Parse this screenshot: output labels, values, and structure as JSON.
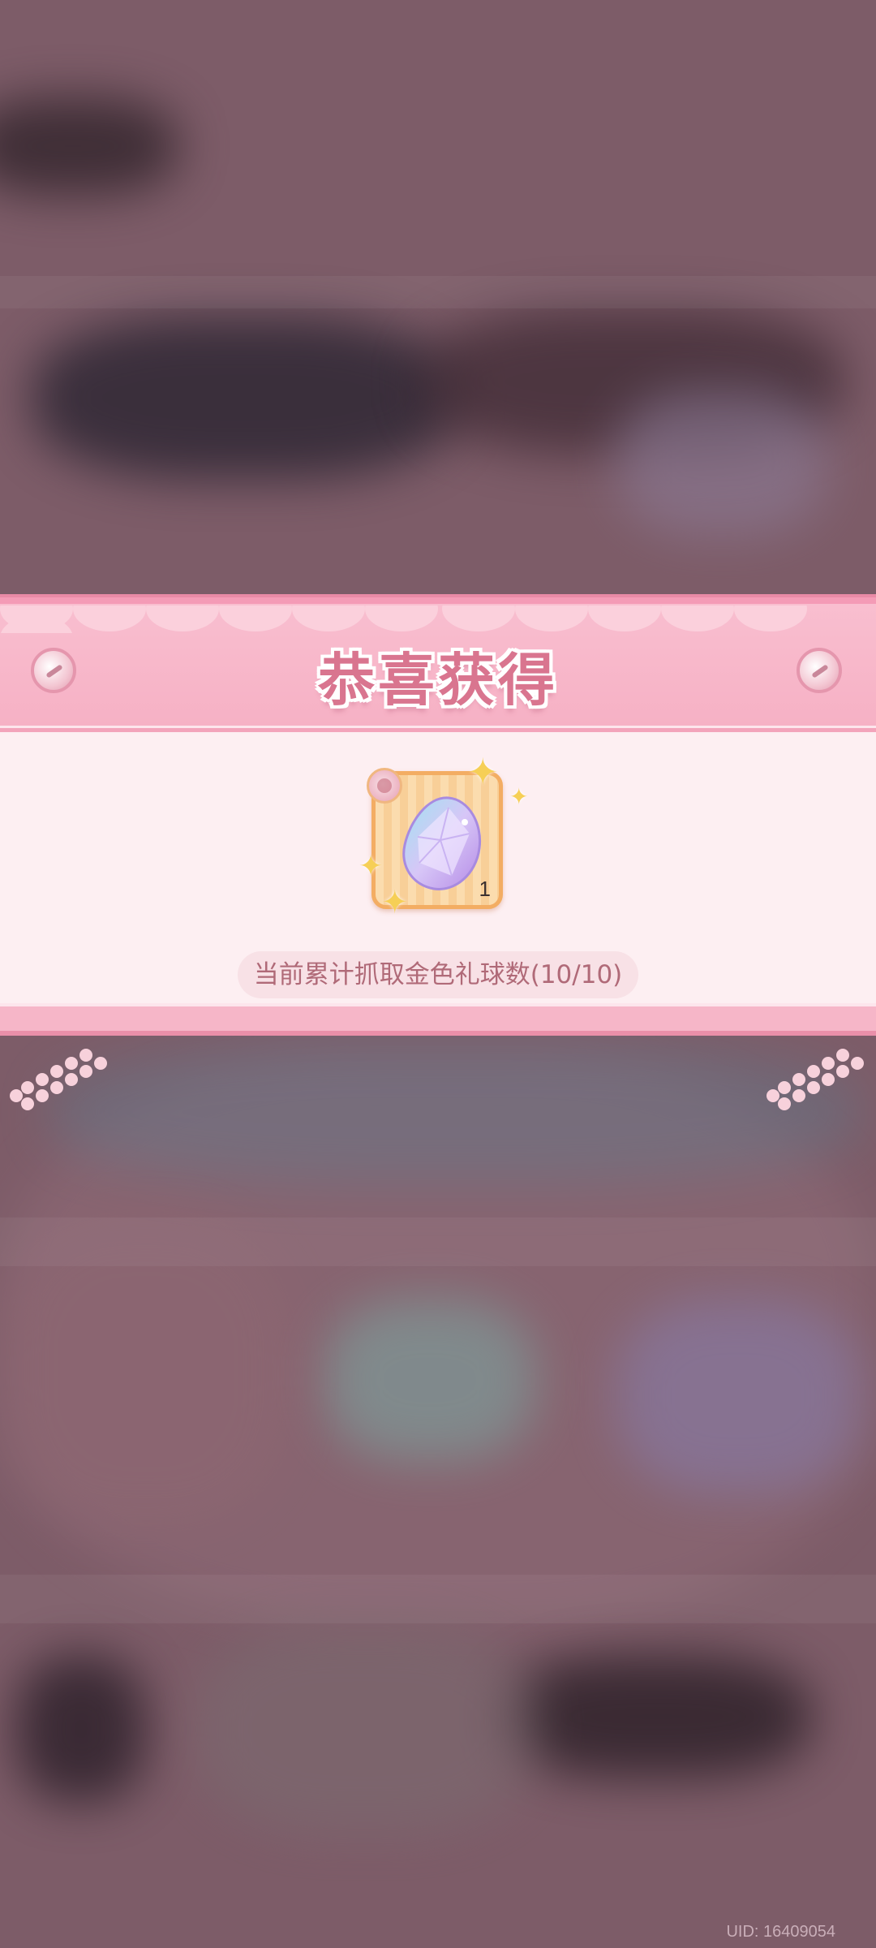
{
  "reward_popup": {
    "title": "恭喜获得",
    "item": {
      "icon": "crystal-gem-icon",
      "count": "1",
      "source_badge_icon": "character-badge-icon"
    },
    "progress_text": "当前累计抓取金色礼球数(10/10)"
  },
  "footer": {
    "uid": "UID: 16409054"
  },
  "colors": {
    "header_pink": "#f9bfd0",
    "title_pink": "#d9758f",
    "body_bg": "#fdeff2",
    "card_orange": "#f3ad63",
    "sparkle_gold": "#f6cf56"
  }
}
